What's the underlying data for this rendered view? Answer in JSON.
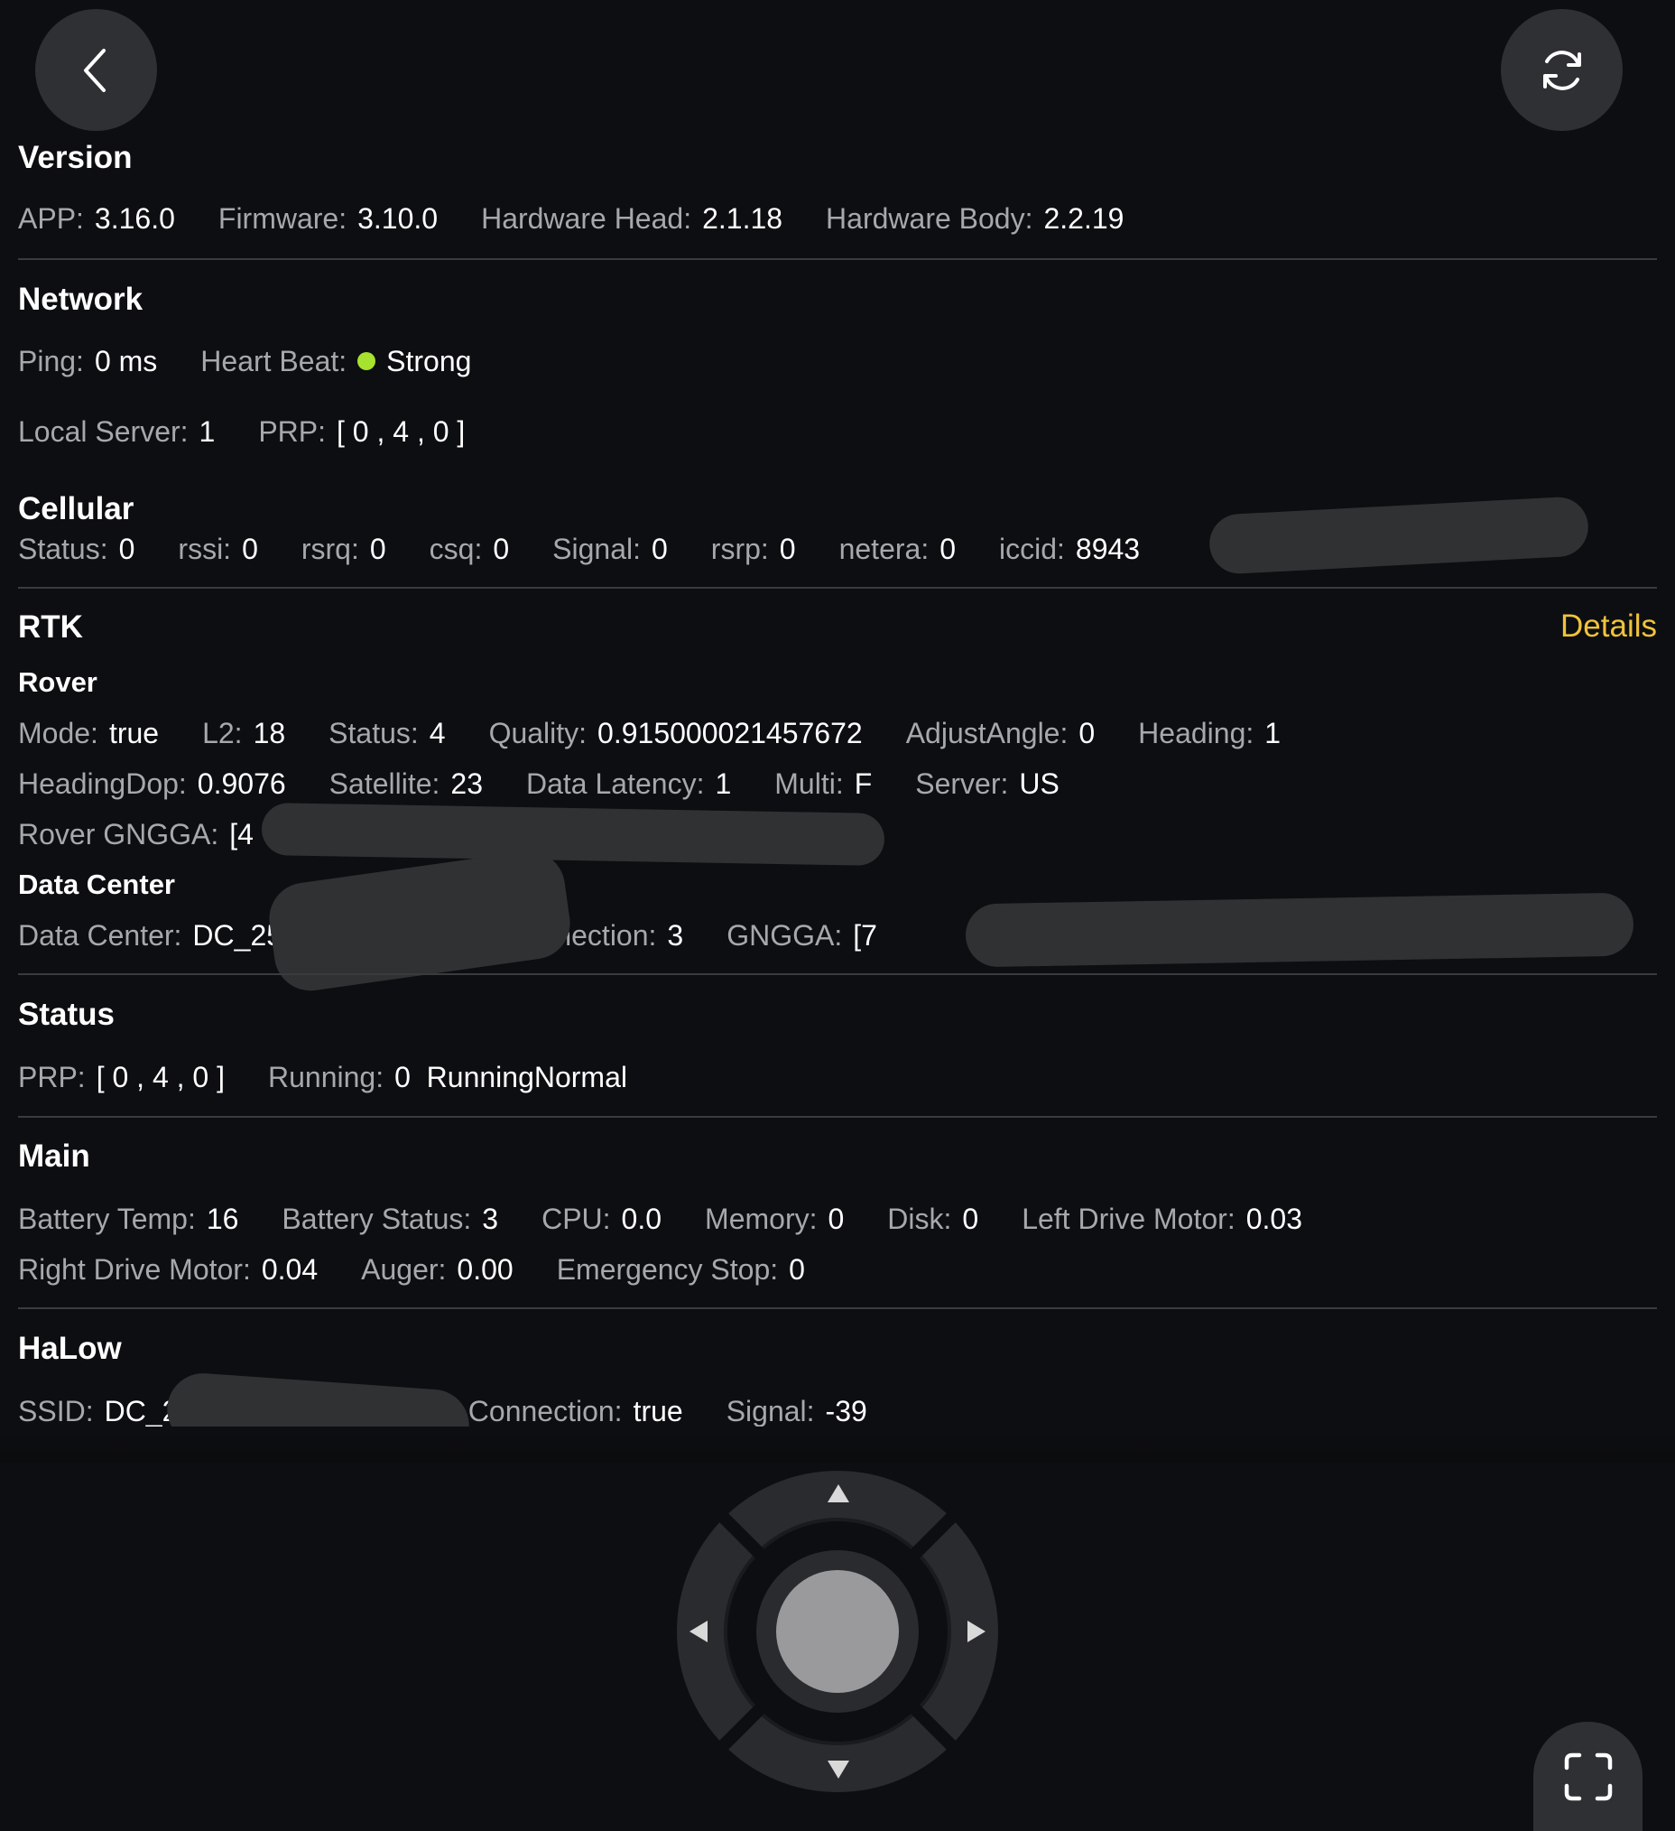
{
  "version": {
    "title": "Version",
    "items": [
      {
        "label": "APP:",
        "value": "3.16.0"
      },
      {
        "label": "Firmware:",
        "value": "3.10.0"
      },
      {
        "label": "Hardware Head:",
        "value": "2.1.18"
      },
      {
        "label": "Hardware Body:",
        "value": "2.2.19"
      }
    ]
  },
  "network": {
    "title": "Network",
    "ping_label": "Ping:",
    "ping_value": "0 ms",
    "heartbeat_label": "Heart Beat:",
    "heartbeat_value": "Strong",
    "heartbeat_color": "#a6e22e",
    "local_server_label": "Local Server:",
    "local_server_value": "1",
    "prp_label": "PRP:",
    "prp_value": "[ 0 , 4 , 0 ]"
  },
  "cellular": {
    "title": "Cellular",
    "items": [
      {
        "label": "Status:",
        "value": "0"
      },
      {
        "label": "rssi:",
        "value": "0"
      },
      {
        "label": "rsrq:",
        "value": "0"
      },
      {
        "label": "csq:",
        "value": "0"
      },
      {
        "label": "Signal:",
        "value": "0"
      },
      {
        "label": "rsrp:",
        "value": "0"
      },
      {
        "label": "netera:",
        "value": "0"
      },
      {
        "label": "iccid:",
        "value": "8943"
      }
    ]
  },
  "rtk": {
    "title": "RTK",
    "details_label": "Details",
    "details_color": "#f0c33c",
    "rover_title": "Rover",
    "rover_row1": [
      {
        "label": "Mode:",
        "value": "true"
      },
      {
        "label": "L2:",
        "value": "18"
      },
      {
        "label": "Status:",
        "value": "4"
      },
      {
        "label": "Quality:",
        "value": "0.915000021457672"
      },
      {
        "label": "AdjustAngle:",
        "value": "0"
      },
      {
        "label": "Heading:",
        "value": "1"
      }
    ],
    "rover_row2": [
      {
        "label": "HeadingDop:",
        "value": "0.9076"
      },
      {
        "label": "Satellite:",
        "value": "23"
      },
      {
        "label": "Data Latency:",
        "value": "1"
      },
      {
        "label": "Multi:",
        "value": "F"
      },
      {
        "label": "Server:",
        "value": "US"
      }
    ],
    "rover_gngga_label": "Rover GNGGA:",
    "rover_gngga_value": "[4",
    "data_center_title": "Data Center",
    "dc_label": "Data Center:",
    "dc_value": "DC_2522",
    "dc_connection_label": "Connection:",
    "dc_connection_value": "3",
    "dc_gngga_label": "GNGGA:",
    "dc_gngga_value": "[7"
  },
  "status": {
    "title": "Status",
    "prp_label": "PRP:",
    "prp_value": "[ 0 , 4 , 0 ]",
    "running_label": "Running:",
    "running_value": "0  RunningNormal"
  },
  "main": {
    "title": "Main",
    "row1": [
      {
        "label": "Battery Temp:",
        "value": "16"
      },
      {
        "label": "Battery Status:",
        "value": "3"
      },
      {
        "label": "CPU:",
        "value": "0.0"
      },
      {
        "label": "Memory:",
        "value": "0"
      },
      {
        "label": "Disk:",
        "value": "0"
      },
      {
        "label": "Left Drive Motor:",
        "value": "0.03"
      }
    ],
    "row2": [
      {
        "label": "Right Drive Motor:",
        "value": "0.04"
      },
      {
        "label": "Auger:",
        "value": "0.00"
      },
      {
        "label": "Emergency Stop:",
        "value": "0"
      }
    ]
  },
  "halow": {
    "title": "HaLow",
    "ssid_label": "SSID:",
    "ssid_value": "DC_2522",
    "connection_label": "Connection:",
    "connection_value": "true",
    "signal_label": "Signal:",
    "signal_value": "-39"
  },
  "controls": {
    "back_icon": "chevron-left-icon",
    "refresh_icon": "refresh-icon",
    "fullscreen_icon": "fullscreen-icon",
    "joystick_icon": "dpad-joystick"
  }
}
